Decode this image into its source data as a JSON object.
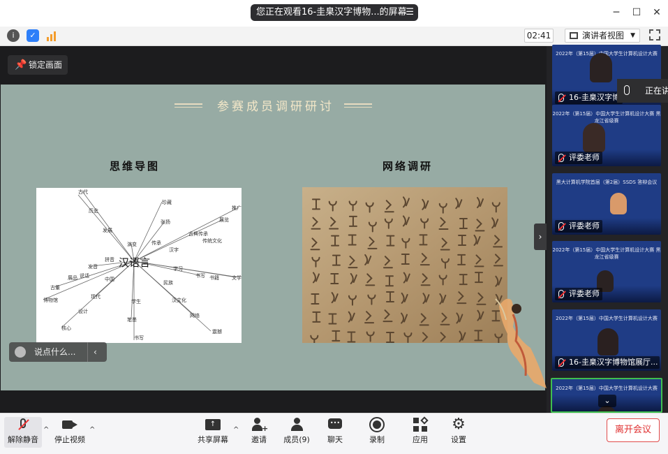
{
  "window": {
    "share_banner": "您正在观看16-圭臬汉字博物...的屏幕",
    "menu_icon": "menu-lines-icon",
    "minimize": "─",
    "maximize": "☐",
    "close": "✕"
  },
  "toolbar": {
    "timer": "02:41",
    "view_mode": "演讲者视图"
  },
  "stage": {
    "lock_label": "锁定画面",
    "chat_placeholder": "说点什么..."
  },
  "slide": {
    "title": "参赛成员调研研讨",
    "left_heading": "思维导图",
    "right_heading": "网络调研",
    "mindmap": {
      "center": "汉语言",
      "nodes": [
        "古代",
        "历史",
        "发展",
        "演变",
        "传承",
        "珍藏",
        "张扬",
        "传统文化",
        "古典传承",
        "展览",
        "推广",
        "汉字",
        "书写",
        "学习",
        "书籍",
        "文学",
        "民族",
        "汉文化",
        "网络",
        "震撼",
        "拼音",
        "发音",
        "说话",
        "学生",
        "笔墨",
        "书写",
        "中国",
        "现代",
        "设计",
        "核心",
        "古董",
        "展品",
        "博物馆"
      ]
    }
  },
  "participants": [
    {
      "name": "16-圭臬汉字博",
      "banner": "2022年（第15届）中国大学生计算机设计大赛"
    },
    {
      "name": "评委老师",
      "banner": "2022年（第15届）中国大学生计算机设计大赛 黑龙江省级赛"
    },
    {
      "name": "评委老师",
      "banner": "黑大计算机学院首届（第2届）SSDS 答辩会议"
    },
    {
      "name": "评委老师",
      "banner": "2022年（第15届）中国大学生计算机设计大赛 黑龙江省级赛"
    },
    {
      "name": "16-圭臬汉字博物馆展厅...",
      "banner": "2022年（第15届）中国大学生计算机设计大赛"
    },
    {
      "name": "",
      "banner": "2022年（第15届）中国大学生计算机设计大赛"
    }
  ],
  "speaking": "正在讲",
  "bottom": {
    "unmute": "解除静音",
    "stop_video": "停止视频",
    "share": "共享屏幕",
    "invite": "邀请",
    "members": "成员(9)",
    "chat": "聊天",
    "record": "录制",
    "apps": "应用",
    "settings": "设置",
    "leave": "离开会议"
  },
  "colors": {
    "slide_bg": "#97aba4",
    "tile_bg": "#1f3c85",
    "leave_red": "#e03030",
    "active_border": "#3fbf4f"
  }
}
